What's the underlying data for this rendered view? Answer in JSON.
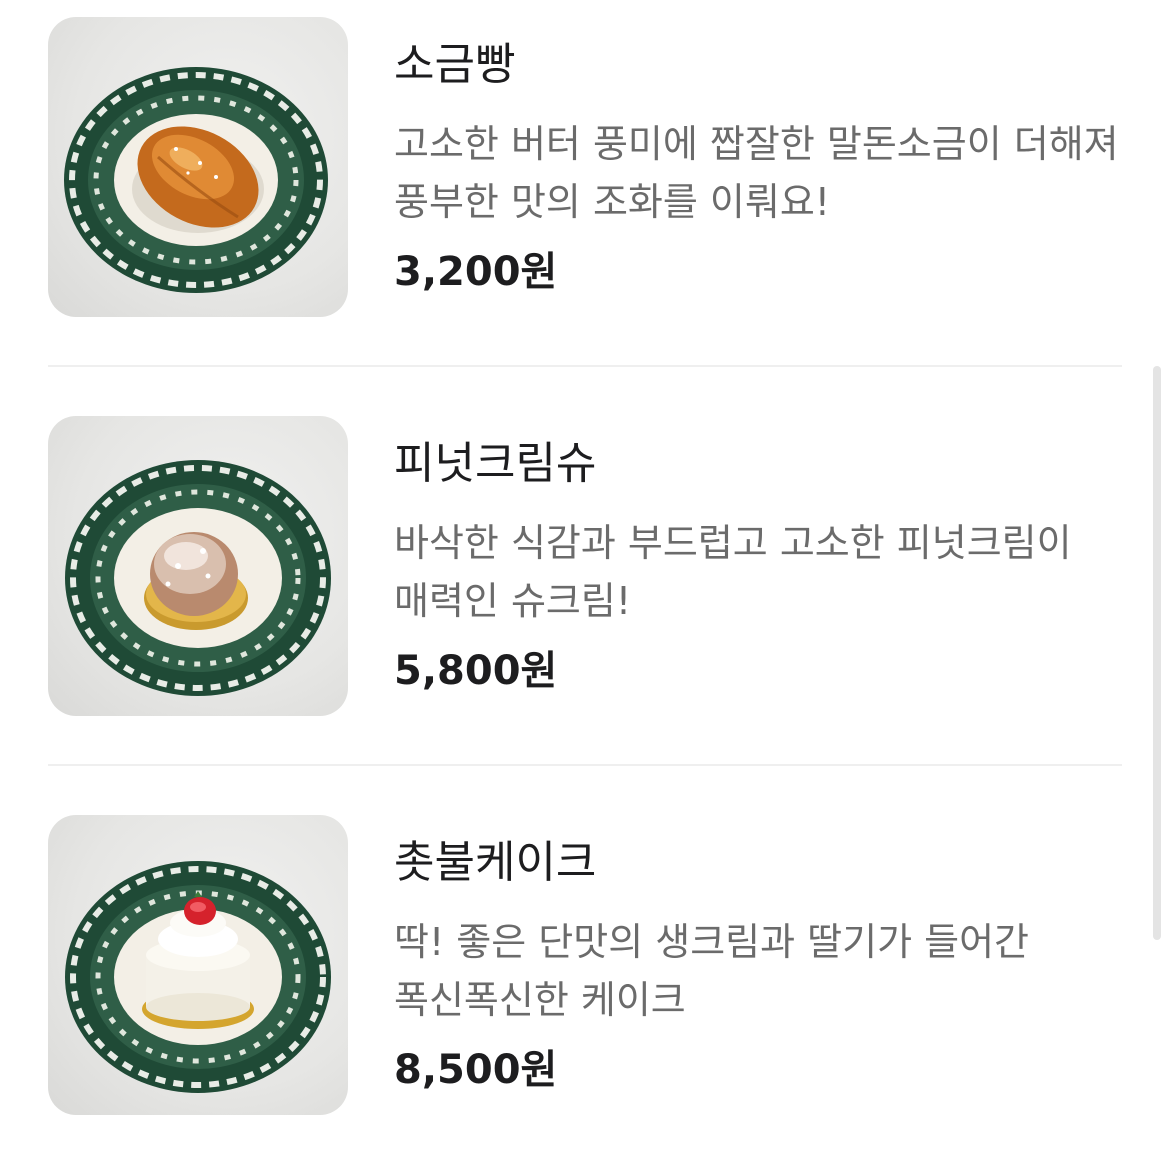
{
  "menu": {
    "items": [
      {
        "name": "소금빵",
        "description": "고소한 버터 풍미에 짭잘한 말돈소금이 더해져 풍부한 맛의 조화를 이뤄요!",
        "price": "3,200원",
        "image_icon": "salt-bread-photo"
      },
      {
        "name": "피넛크림슈",
        "description": "바삭한 식감과 부드럽고 고소한 피넛크림이 매력인 슈크림!",
        "price": "5,800원",
        "image_icon": "cream-puff-photo"
      },
      {
        "name": "촛불케이크",
        "description": "딱! 좋은 단맛의 생크림과 딸기가 들어간 폭신폭신한 케이크",
        "price": "8,500원",
        "image_icon": "strawberry-cake-photo"
      }
    ]
  },
  "colors": {
    "title_text": "#1d1d1f",
    "description_text": "#6b6b6b",
    "divider": "#efefef",
    "plate_green": "#1f4a36"
  }
}
